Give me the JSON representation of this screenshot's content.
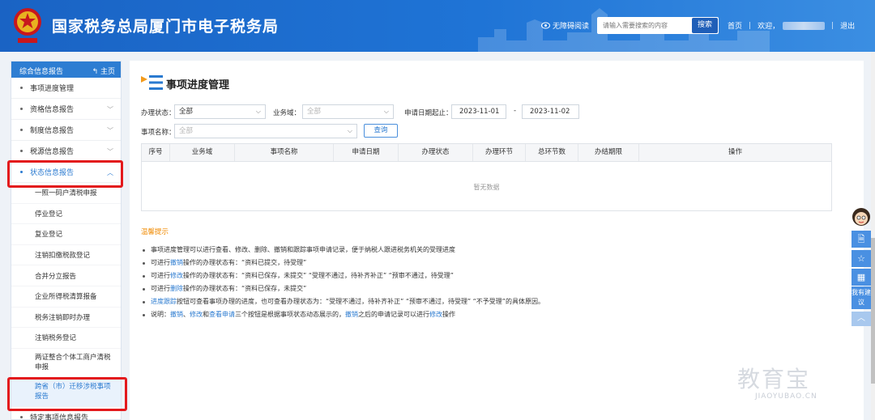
{
  "header": {
    "site_title": "国家税务总局厦门市电子税务局",
    "accessibility_label": "无障碍阅读",
    "search_placeholder": "请输入需要搜索的内容",
    "search_button": "搜索",
    "home_link": "首页",
    "welcome_label": "欢迎，",
    "logout_link": "退出",
    "accent_color": "#1f74d6"
  },
  "sidebar": {
    "section_title": "综合信息报告",
    "home_link": "主页",
    "items": [
      {
        "label": "事项进度管理",
        "has_children": false
      },
      {
        "label": "资格信息报告",
        "has_children": true
      },
      {
        "label": "制度信息报告",
        "has_children": true
      },
      {
        "label": "税源信息报告",
        "has_children": true
      },
      {
        "label": "状态信息报告",
        "has_children": true,
        "expanded": true
      }
    ],
    "sub_items": [
      "一照一码户清税申报",
      "停业登记",
      "复业登记",
      "注销扣缴税款登记",
      "合并分立报告",
      "企业所得税清算报备",
      "税务注销即时办理",
      "注销税务登记",
      "两证整合个体工商户清税申报",
      "跨省（市）迁移涉税事项报告"
    ],
    "next_item": "特定事项信息报告"
  },
  "main": {
    "page_title": "事项进度管理",
    "filters": {
      "status_label": "办理状态：",
      "status_value": "全部",
      "domain_label": "业务域：",
      "domain_placeholder": "全部",
      "date_label": "申请日期起止：",
      "date_from": "2023-11-01",
      "date_sep": "-",
      "date_to": "2023-11-02",
      "item_name_label": "事项名称：",
      "item_name_placeholder": "全部",
      "query_button": "查询"
    },
    "table": {
      "columns": [
        "序号",
        "业务域",
        "事项名称",
        "申请日期",
        "办理状态",
        "办理环节",
        "总环节数",
        "办结期限",
        "操作"
      ],
      "empty_text": "暂无数据"
    },
    "tips_title": "温馨提示",
    "tips": [
      [
        {
          "t": "事项进度管理可以进行查看、修改、删除、撤销和跟踪事项申请记录，便于纳税人跟进税务机关的受理进度"
        }
      ],
      [
        {
          "t": "可进行"
        },
        {
          "t": "撤销",
          "link": true
        },
        {
          "t": "操作的办理状态有：“资料已提交，待受理”"
        }
      ],
      [
        {
          "t": "可进行"
        },
        {
          "t": "修改",
          "link": true
        },
        {
          "t": "操作的办理状态有：“资料已保存，未提交”    “受理不通过，待补齐补正”    “预审不通过，待受理”"
        }
      ],
      [
        {
          "t": "可进行"
        },
        {
          "t": "删除",
          "link": true
        },
        {
          "t": "操作的办理状态有：“资料已保存，未提交”"
        }
      ],
      [
        {
          "t": "进度跟踪",
          "link": true
        },
        {
          "t": "按钮可查看事项办理的进度，也可查看办理状态为：“受理不通过，待补齐补正”    “预审不通过，待受理”    “不予受理”的具体原因。"
        }
      ],
      [
        {
          "t": "说明："
        },
        {
          "t": "撤销",
          "link": true
        },
        {
          "t": "、"
        },
        {
          "t": "修改",
          "link": true
        },
        {
          "t": "和"
        },
        {
          "t": "查看申请",
          "link": true
        },
        {
          "t": "三个按钮是根据事项状态动态展示的，"
        },
        {
          "t": "撤销",
          "link": true
        },
        {
          "t": "之后的申请记录可以进行"
        },
        {
          "t": "修改",
          "link": true
        },
        {
          "t": "操作"
        }
      ]
    ]
  },
  "float_toolbar": {
    "suggest_label": "我有建议",
    "icons": [
      "assistant-avatar-icon",
      "document-icon",
      "star-icon",
      "calculator-icon",
      "up-arrow-icon"
    ]
  },
  "watermark": {
    "big": "教育宝",
    "small": "JIAOYUBAO.CN"
  }
}
